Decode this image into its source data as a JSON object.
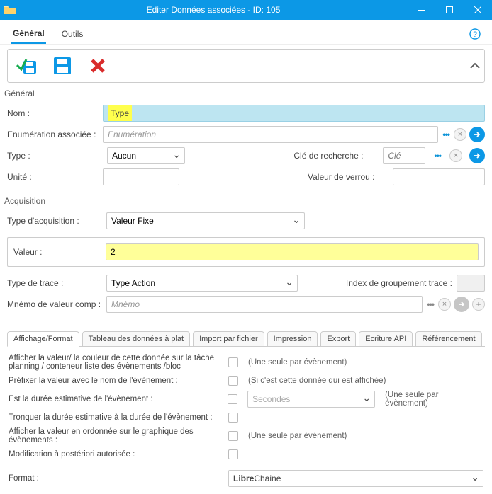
{
  "window": {
    "title": "Editer Données associées - ID: 105"
  },
  "topTabs": {
    "general": "Général",
    "outils": "Outils"
  },
  "sections": {
    "general": "Général",
    "acquisition": "Acquisition"
  },
  "general": {
    "nom_label": "Nom :",
    "nom_value": "Type",
    "enum_label": "Enumération associée :",
    "enum_placeholder": "Enumération",
    "type_label": "Type :",
    "type_value": "Aucun",
    "unit_label": "Unité :",
    "unit_value": "",
    "cle_label": "Clé de recherche :",
    "cle_placeholder": "Clé",
    "verrou_label": "Valeur de verrou :",
    "verrou_value": ""
  },
  "acquisition": {
    "typeacq_label": "Type d'acquisition :",
    "typeacq_value": "Valeur Fixe",
    "valeur_label": "Valeur :",
    "valeur_value": "2",
    "trace_label": "Type de trace :",
    "trace_value": "Type Action",
    "index_label": "Index de groupement trace :",
    "index_value": "",
    "mnemo_label": "Mnémo de valeur comp :",
    "mnemo_placeholder": "Mnémo"
  },
  "subTabs": {
    "t0": "Affichage/Format",
    "t1": "Tableau des données à plat",
    "t2": "Import par fichier",
    "t3": "Impression",
    "t4": "Export",
    "t5": "Ecriture API",
    "t6": "Référencement"
  },
  "affichage": {
    "r1": "Afficher la valeur/ la couleur de cette donnée sur la tâche planning / conteneur liste des évènements /bloc",
    "r1n": "(Une seule par évènement)",
    "r2": "Préfixer la valeur avec le nom de l'évènement :",
    "r2n": "(Si c'est cette donnée qui est affichée)",
    "r3": "Est la durée estimative de l'évènement :",
    "r3sel": "Secondes",
    "r3n": "(Une seule par évènement)",
    "r4": "Tronquer la durée estimative à la durée de l'évènement :",
    "r5": "Afficher la valeur en ordonnée sur le graphique des évènements :",
    "r5n": "(Une seule par évènement)",
    "r6": "Modification à postériori autorisée :",
    "format_label": "Format :",
    "format_value": "Libre Chaine"
  }
}
